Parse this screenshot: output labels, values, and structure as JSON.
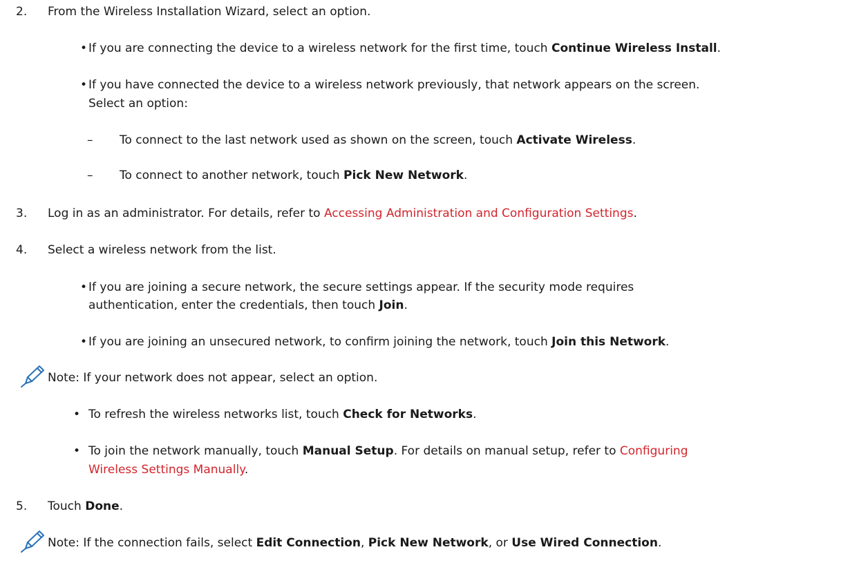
{
  "step2": {
    "num": "2.",
    "text": "From the Wireless Installation Wizard, select an option.",
    "bullet1": {
      "pre": "If you are connecting the device to a wireless network for the first time, touch ",
      "bold": "Continue Wireless Install",
      "post": "."
    },
    "bullet2": {
      "line1": "If you have connected the device to a wireless network previously, that network appears on the screen.",
      "line2": "Select an option:"
    },
    "dash1": {
      "pre": "To connect to the last network used as shown on the screen, touch ",
      "bold": "Activate Wireless",
      "post": "."
    },
    "dash2": {
      "pre": "To connect to another network, touch ",
      "bold": "Pick New Network",
      "post": "."
    },
    "dash_glyph": "–",
    "bullet_glyph": "•"
  },
  "step3": {
    "num": "3.",
    "pre": "Log in as an administrator. For details, refer to ",
    "link": "Accessing Administration and Configuration Settings",
    "post": "."
  },
  "step4": {
    "num": "4.",
    "text": "Select a wireless network from the list.",
    "bullet1": {
      "line1": "If you are joining a secure network, the secure settings appear. If the security mode requires",
      "line2_pre": "authentication, enter the credentials, then touch ",
      "line2_bold": "Join",
      "line2_post": "."
    },
    "bullet2": {
      "pre": "If you are joining an unsecured network, to confirm joining the network, touch ",
      "bold": "Join this Network",
      "post": "."
    }
  },
  "note1": {
    "text": "Note: If your network does not appear, select an option.",
    "bullet1": {
      "pre": "To refresh the wireless networks list, touch ",
      "bold": "Check for Networks",
      "post": "."
    },
    "bullet2": {
      "line1_pre": "To join the network manually, touch ",
      "line1_bold": "Manual Setup",
      "line1_mid": ". For details on manual setup, refer to ",
      "line1_link": "Configuring",
      "line2_link": "Wireless Settings Manually",
      "line2_post": "."
    }
  },
  "step5": {
    "num": "5.",
    "pre": "Touch ",
    "bold": "Done",
    "post": "."
  },
  "note2": {
    "pre": "Note: If the connection fails, select ",
    "bold1": "Edit Connection",
    "sep1": ", ",
    "bold2": "Pick New Network",
    "sep2": ", or ",
    "bold3": "Use Wired Connection",
    "post": "."
  },
  "colors": {
    "link": "#d1252c",
    "icon": "#2a72b8",
    "text": "#1a1a1a"
  }
}
